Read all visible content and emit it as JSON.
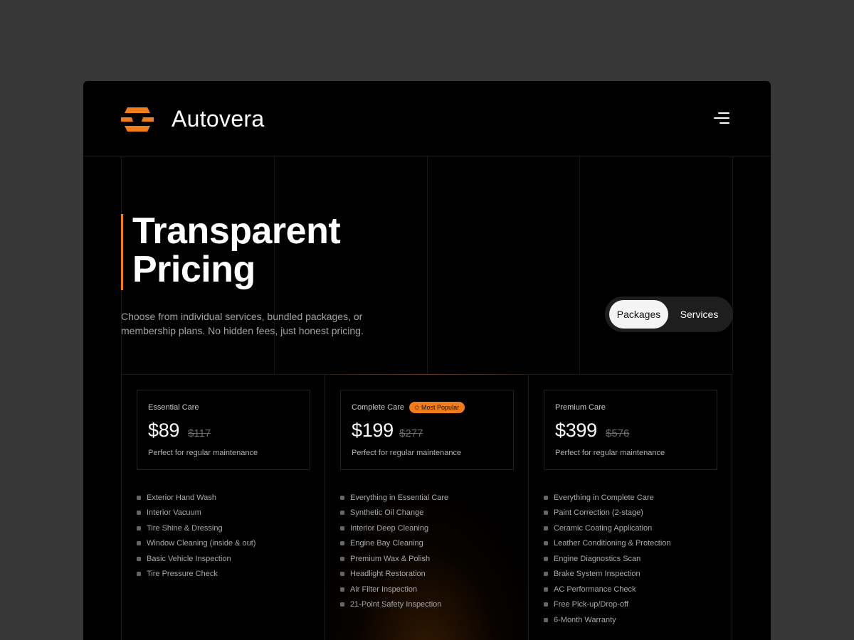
{
  "brand": {
    "name": "Autovera",
    "accent": "#f07c1b"
  },
  "header": {
    "menu_icon": "hamburger-menu-icon"
  },
  "hero": {
    "title_line1": "Transparent",
    "title_line2": "Pricing",
    "subtitle": "Choose from individual services, bundled packages, or membership plans. No hidden fees, just honest pricing."
  },
  "toggle": {
    "options": [
      "Packages",
      "Services"
    ],
    "selected": "Packages"
  },
  "plans": [
    {
      "name": "Essential Care",
      "price": "$89",
      "old_price": "$117",
      "description": "Perfect for regular maintenance",
      "features": [
        "Exterior Hand Wash",
        "Interior Vacuum",
        "Tire Shine & Dressing",
        "Window Cleaning (inside & out)",
        "Basic Vehicle Inspection",
        "Tire Pressure Check"
      ]
    },
    {
      "name": "Complete Care",
      "badge": "✩ Most Popular",
      "price": "$199",
      "old_price": "$277",
      "description": "Perfect for regular maintenance",
      "features": [
        "Everything in Essential Care",
        "Synthetic Oil Change",
        "Interior Deep Cleaning",
        "Engine Bay Cleaning",
        "Premium Wax & Polish",
        "Headlight Restoration",
        "Air Filter Inspection",
        "21-Point Safety Inspection"
      ]
    },
    {
      "name": "Premium Care",
      "price": "$399",
      "old_price": "$576",
      "description": "Perfect for regular maintenance",
      "features": [
        "Everything in Complete Care",
        "Paint Correction (2-stage)",
        "Ceramic Coating Application",
        "Leather Conditioning & Protection",
        "Engine Diagnostics Scan",
        "Brake System Inspection",
        "AC Performance Check",
        "Free Pick-up/Drop-off",
        "6-Month Warranty"
      ]
    }
  ]
}
